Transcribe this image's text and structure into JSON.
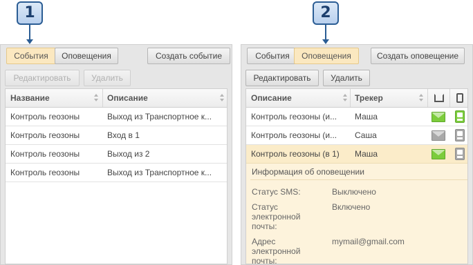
{
  "callouts": [
    "1",
    "2"
  ],
  "left": {
    "tabs": [
      {
        "label": "События",
        "active": true
      },
      {
        "label": "Оповещения",
        "active": false
      }
    ],
    "create_button": "Создать событие",
    "edit_button": "Редактировать",
    "delete_button": "Удалить",
    "columns": [
      "Название",
      "Описание"
    ],
    "rows": [
      {
        "name": "Контроль геозоны",
        "desc": "Выход из Транспортное к..."
      },
      {
        "name": "Контроль геозоны",
        "desc": "Вход в 1"
      },
      {
        "name": "Контроль геозоны",
        "desc": "Выход из 2"
      },
      {
        "name": "Контроль геозоны",
        "desc": "Выход из Транспортное к..."
      }
    ]
  },
  "right": {
    "tabs": [
      {
        "label": "События",
        "active": false
      },
      {
        "label": "Оповещения",
        "active": true
      }
    ],
    "create_button": "Создать оповещение",
    "edit_button": "Редактировать",
    "delete_button": "Удалить",
    "columns": [
      "Описание",
      "Трекер"
    ],
    "rows": [
      {
        "desc": "Контроль геозоны (и...",
        "tracker": "Маша",
        "email": "on",
        "device": "on"
      },
      {
        "desc": "Контроль геозоны (и...",
        "tracker": "Саша",
        "email": "off",
        "device": "off"
      },
      {
        "desc": "Контроль геозоны (в 1)",
        "tracker": "Маша",
        "email": "on",
        "device": "off",
        "selected": true
      }
    ],
    "info": {
      "title": "Информация об оповещении",
      "fields": [
        {
          "label": "Статус SMS:",
          "value": "Выключено"
        },
        {
          "label": "Статус электронной почты:",
          "value": "Включено"
        },
        {
          "label": "Адрес электронной почты:",
          "value": "mymail@gmail.com"
        }
      ]
    }
  },
  "icons": {
    "email_column": "envelope-open-icon",
    "device_column": "tracker-device-icon",
    "sort": "sort-arrows-icon"
  },
  "colors": {
    "active_tab": "#fbe8c0",
    "selected_row": "#fbecc9",
    "info_background": "#fdf3dc",
    "callout_border": "#2b5d94",
    "icon_on": "#7ccc3c",
    "icon_off": "#a9a9a9"
  }
}
